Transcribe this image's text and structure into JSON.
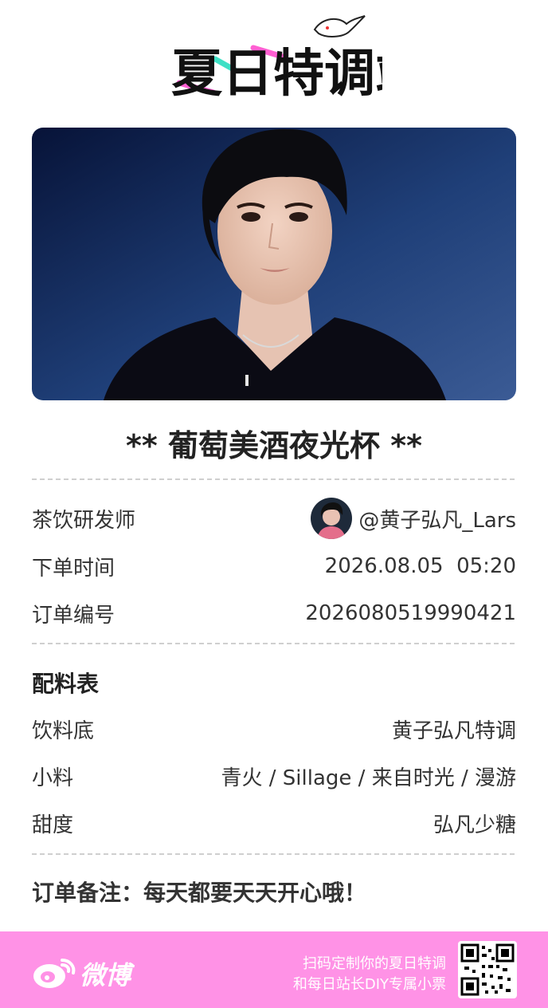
{
  "logo": {
    "text": "夏日特调站",
    "icon": "seagull-icon"
  },
  "hero": {
    "image": "portrait-photo"
  },
  "title": "** 葡萄美酒夜光杯 **",
  "order": {
    "developer_label": "茶饮研发师",
    "developer_value": "@黄子弘凡_Lars",
    "time_label": "下单时间",
    "time_value": "2026.08.05  05:20",
    "number_label": "订单编号",
    "number_value": "2026080519990421"
  },
  "ingredients": {
    "heading": "配料表",
    "base_label": "饮料底",
    "base_value": "黄子弘凡特调",
    "topping_label": "小料",
    "topping_value": "青火 / Sillage / 来自时光 / 漫游",
    "sweet_label": "甜度",
    "sweet_value": "弘凡少糖"
  },
  "note": "订单备注：每天都要天天开心哦！",
  "footer": {
    "brand": "微博",
    "scan_line1": "扫码定制你的夏日特调",
    "scan_line2": "和每日站长DIY专属小票",
    "qr_icon": "qr-code-icon",
    "bg_color": "#ff92e6"
  },
  "colors": {
    "accent_pink": "#ff5fd2",
    "accent_teal": "#3fe0c5",
    "divider": "#cfcfcf"
  }
}
